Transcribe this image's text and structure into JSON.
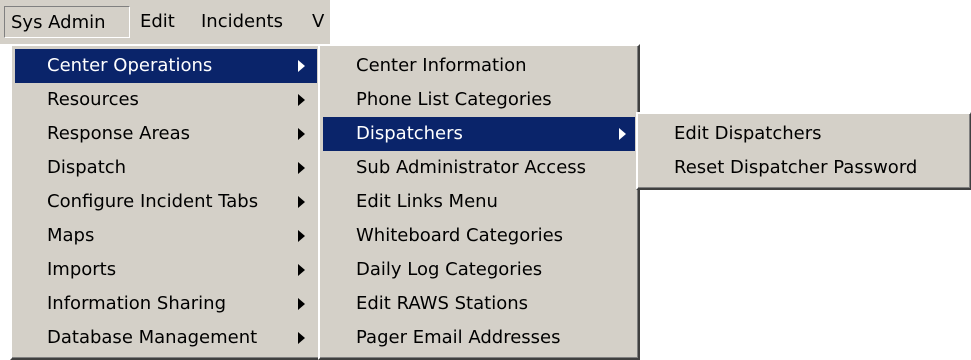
{
  "menubar": {
    "items": [
      "Sys Admin",
      "Edit",
      "Incidents",
      "V"
    ]
  },
  "sys_admin_menu": {
    "items": [
      {
        "label": "Center Operations",
        "has_submenu": true,
        "highlighted": true
      },
      {
        "label": "Resources",
        "has_submenu": true
      },
      {
        "label": "Response Areas",
        "has_submenu": true
      },
      {
        "label": "Dispatch",
        "has_submenu": true
      },
      {
        "label": "Configure Incident Tabs",
        "has_submenu": true
      },
      {
        "label": "Maps",
        "has_submenu": true
      },
      {
        "label": "Imports",
        "has_submenu": true
      },
      {
        "label": "Information Sharing",
        "has_submenu": true
      },
      {
        "label": "Database Management",
        "has_submenu": true
      }
    ]
  },
  "center_operations_menu": {
    "items": [
      {
        "label": "Center Information",
        "has_submenu": false
      },
      {
        "label": "Phone List Categories",
        "has_submenu": false
      },
      {
        "label": "Dispatchers",
        "has_submenu": true,
        "highlighted": true
      },
      {
        "label": "Sub Administrator Access",
        "has_submenu": false
      },
      {
        "label": "Edit Links Menu",
        "has_submenu": false
      },
      {
        "label": "Whiteboard Categories",
        "has_submenu": false
      },
      {
        "label": "Daily Log Categories",
        "has_submenu": false
      },
      {
        "label": "Edit RAWS Stations",
        "has_submenu": false
      },
      {
        "label": "Pager Email Addresses",
        "has_submenu": false
      }
    ]
  },
  "dispatchers_menu": {
    "items": [
      {
        "label": "Edit Dispatchers"
      },
      {
        "label": "Reset Dispatcher Password"
      }
    ]
  },
  "colors": {
    "menu_bg": "#d4d0c8",
    "highlight_bg": "#0a246a",
    "highlight_text": "#ffffff"
  },
  "icons": {
    "submenu": "submenu-arrow-icon"
  }
}
